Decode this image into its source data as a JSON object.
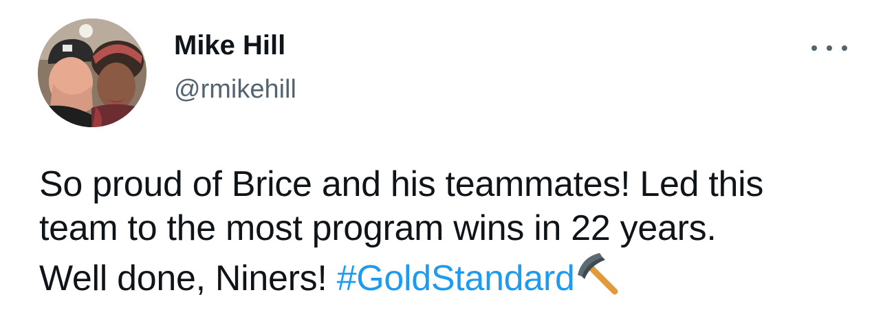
{
  "tweet": {
    "author": {
      "display_name": "Mike Hill",
      "handle": "@rmikehill",
      "avatar_icon": "profile-photo"
    },
    "more_icon": "more-options-icon",
    "text": {
      "line1": "So proud of Brice and his teammates! Led this",
      "line2": "team to the most program wins in 22 years.",
      "line3_prefix": "Well done, Niners! ",
      "hashtag": "#GoldStandard",
      "emoji": "pick-icon"
    },
    "colors": {
      "text": "#0f1419",
      "secondary": "#536471",
      "link": "#1d9bf0"
    }
  }
}
